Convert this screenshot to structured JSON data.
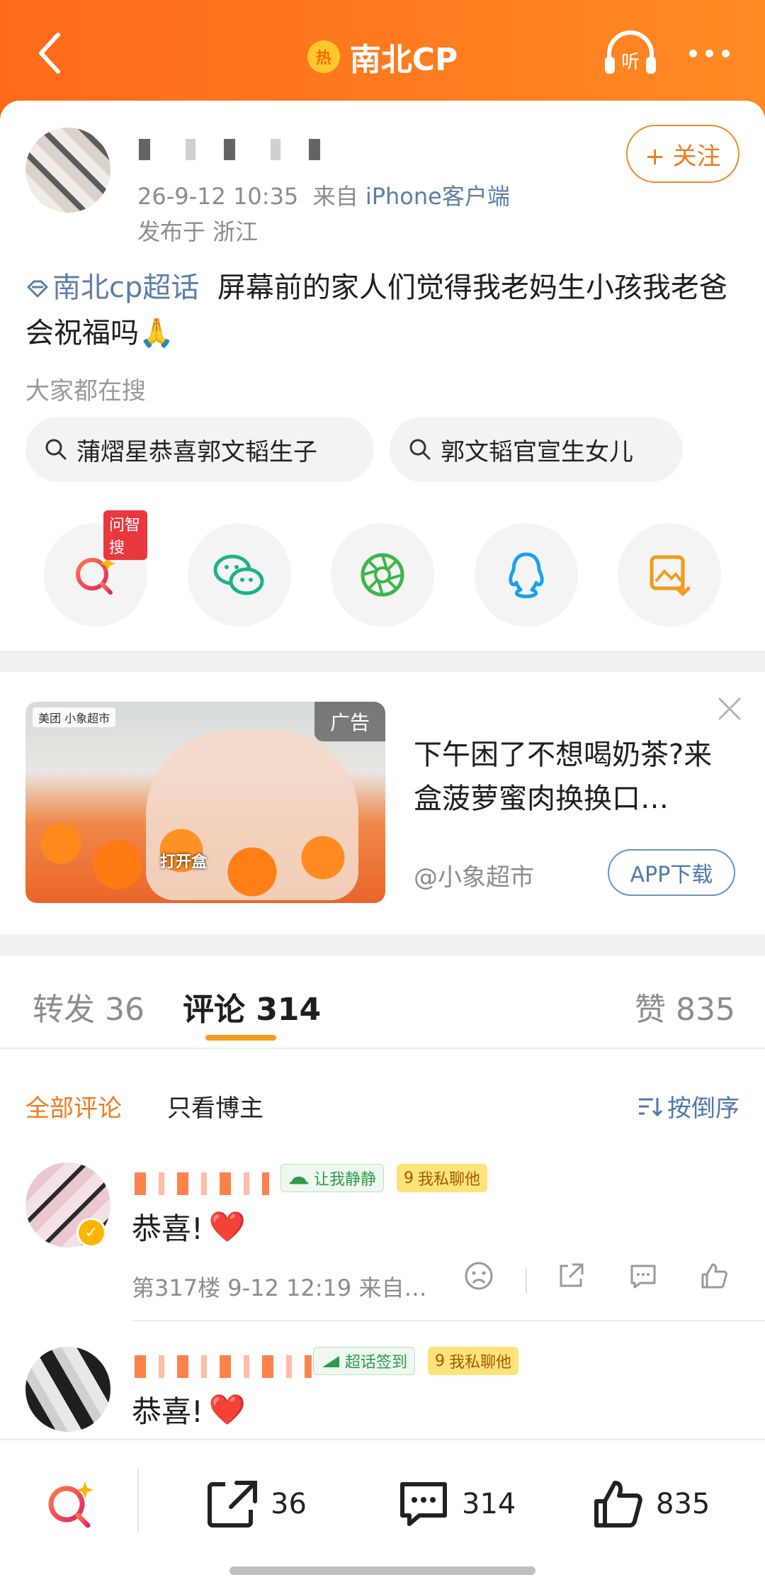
{
  "header": {
    "title": "南北CP",
    "hot_badge": "热",
    "back_icon": "chevron-left-icon",
    "listen_label": "听",
    "more_icon": "more-icon"
  },
  "post": {
    "timestamp": "26-9-12 10:35",
    "source_prefix": "来自",
    "client": "iPhone客户端",
    "location": "发布于 浙江",
    "follow_label": "+ 关注",
    "topic": "南北cp超话",
    "text": "屏幕前的家人们觉得我老妈生小孩我老爸会祝福吗",
    "emoji": "🙏"
  },
  "search": {
    "hint": "大家都在搜",
    "chips": [
      "蒲熠星恭喜郭文韬生子",
      "郭文韬官宣生女儿"
    ]
  },
  "share": {
    "ask_badge": "问智搜",
    "buttons": [
      "ask-search-icon",
      "wechat-icon",
      "moments-icon",
      "qq-icon",
      "save-image-icon"
    ]
  },
  "ad": {
    "tag": "广告",
    "brand": "美团 小象超市",
    "caption": "打开盒",
    "title": "下午困了不想喝奶茶?来盒菠萝蜜肉换换口…",
    "source": "@小象超市",
    "download": "APP下载"
  },
  "tabs": {
    "repost": "转发 36",
    "comments": "评论 314",
    "likes": "赞 835"
  },
  "filters": {
    "all": "全部评论",
    "blogger": "只看博主",
    "sort": "按倒序"
  },
  "comments": [
    {
      "badge1": "让我静静",
      "badge2": "我私聊他",
      "level": "9",
      "text": "恭喜!",
      "heart": "❤️",
      "meta": "第317楼 9-12 12:19 来自…"
    },
    {
      "badge1": "超话签到",
      "badge2": "我私聊他",
      "level": "9",
      "text": "恭喜!",
      "heart": "❤️"
    }
  ],
  "bottom": {
    "repost": "36",
    "comments": "314",
    "likes": "835"
  },
  "colors": {
    "brand": "#ff7d20",
    "link": "#5b7fa8",
    "accent": "#f07b1d"
  }
}
